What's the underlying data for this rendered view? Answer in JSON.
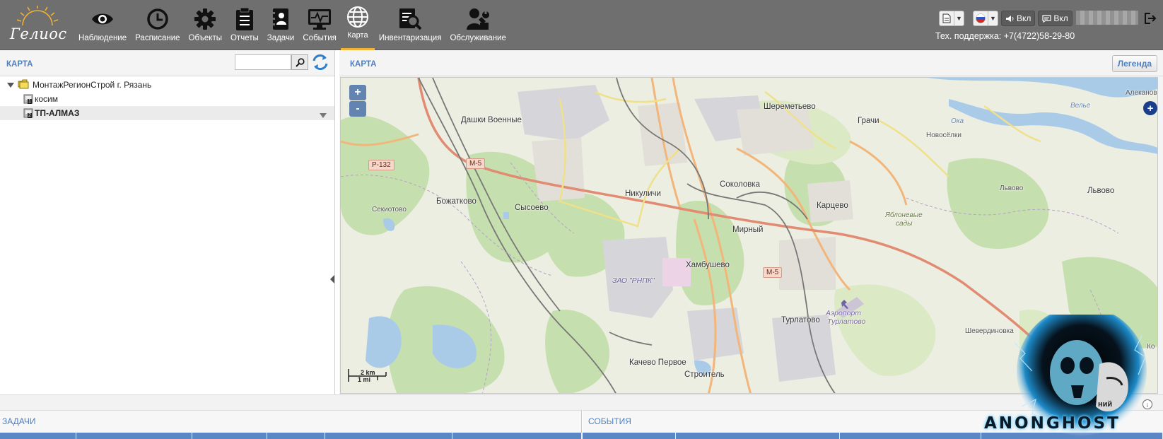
{
  "app": {
    "brand": "Гелиос",
    "support": "Тех. поддержка: +7(4722)58-29-80"
  },
  "nav": [
    {
      "label": "Наблюдение",
      "icon": "eye-icon"
    },
    {
      "label": "Расписание",
      "icon": "clock-icon"
    },
    {
      "label": "Объекты",
      "icon": "gear-icon"
    },
    {
      "label": "Отчеты",
      "icon": "clipboard-icon"
    },
    {
      "label": "Задачи",
      "icon": "task-book-icon"
    },
    {
      "label": "События",
      "icon": "monitor-pulse-icon"
    },
    {
      "label": "Карта",
      "icon": "globe-icon",
      "active": true
    },
    {
      "label": "Инвентаризация",
      "icon": "inventory-search-icon"
    },
    {
      "label": "Обслуживание",
      "icon": "user-wrench-icon"
    }
  ],
  "tools": {
    "sound_label": "Вкл",
    "messages_label": "Вкл"
  },
  "left_panel": {
    "title": "КАРТА",
    "search_placeholder": "",
    "tree": {
      "root": "МонтажРегионСтрой г. Рязань",
      "children": [
        {
          "label": "косим",
          "badge": "1"
        },
        {
          "label": "ТП-АЛМАЗ",
          "badge": "2",
          "selected": true
        }
      ]
    }
  },
  "map_panel": {
    "title": "КАРТА",
    "legend_label": "Легенда",
    "zoom_in": "+",
    "zoom_out": "-",
    "scale_km": "2 km",
    "scale_mi": "1 mi",
    "labels": {
      "dashki": "Дашки Военные",
      "sheremetevo": "Шереметьево",
      "grachi": "Грачи",
      "novoselki": "Новосёлки",
      "vele": "Велье",
      "alekanovo": "Алеканов",
      "oka": "Ока",
      "bozhatkovo": "Божатково",
      "sekiotovo": "Секиотово",
      "sysoevo": "Сысоево",
      "nikulichi": "Никуличи",
      "sokolovka": "Соколовка",
      "kartsevo": "Карцево",
      "yablonevye": "Яблоневые",
      "sady": "сады",
      "lvovo_small": "Львово",
      "lvovo": "Львово",
      "mirny": "Мирный",
      "khambushevo": "Хамбушево",
      "rnpk": "ЗАО \"РНПК\"",
      "airport1": "Аэропорт",
      "airport2": "Турлатово",
      "turlatovo": "Турлатово",
      "shevердinovka": "Шевердиновка",
      "kachevo": "Качево Первое",
      "stroitel": "Строитель",
      "ko": "Ко"
    },
    "shields": {
      "r132": "Р-132",
      "m5a": "М-5",
      "m5b": "М-5"
    }
  },
  "bottom": {
    "tasks_title": "ЗАДАЧИ",
    "events_title": "СОБЫТИЯ",
    "corner_text": "ний"
  },
  "watermark": {
    "text": "ANONGHOST"
  }
}
